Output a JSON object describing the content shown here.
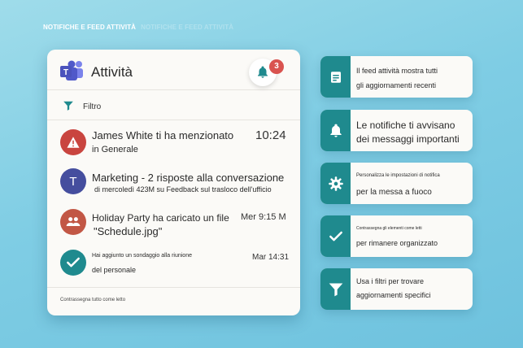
{
  "page": {
    "heading": "NOTIFICHE E FEED ATTIVITÀ",
    "heading_ghost": "NOTIFICHE E FEED ATTIVITÀ"
  },
  "panel": {
    "title": "Attività",
    "badge_count": "3",
    "filter_label": "Filtro",
    "footer_link": "Contrassegna tutto come letto"
  },
  "activity": [
    {
      "title": "James White ti ha menzionato",
      "subtitle": "in Generale",
      "time": "10:24",
      "icon": "alert-icon",
      "color": "#c9453f"
    },
    {
      "title": "Marketing - 2 risposte alla conversazione",
      "subtitle": "di mercoledì 423M su Feedback sul trasloco dell'ufficio",
      "time": "",
      "initial": "T",
      "color": "#454e9e"
    },
    {
      "title": "Holiday Party ha caricato un file",
      "subtitle": "\"Schedule.jpg\"",
      "time": "Mer 9:15 M",
      "icon": "people-icon",
      "color": "#c25745"
    },
    {
      "title": "Hai aggiunto un sondaggio alla riunione",
      "subtitle": "del personale",
      "time": "Mar 14:31",
      "icon": "check-icon",
      "color": "#1f8a8e"
    }
  ],
  "features": [
    {
      "icon": "document-icon",
      "line1": "Il feed attività mostra tutti",
      "line2": "gli aggiornamenti recenti"
    },
    {
      "icon": "bell-icon",
      "line1": "Le notifiche ti avvisano",
      "line2": "dei messaggi importanti"
    },
    {
      "icon": "gear-icon",
      "line1": "Personalizza le impostazioni di notifica",
      "line2": "per la messa a fuoco"
    },
    {
      "icon": "check-icon",
      "line1": "Contrassegna gli elementi come letti",
      "line2": "per rimanere organizzato"
    },
    {
      "icon": "filter-icon",
      "line1": "Usa i filtri per trovare",
      "line2": "aggiornamenti specifici"
    }
  ],
  "colors": {
    "accent": "#1f8a8e",
    "badge": "#d9534f",
    "teams_purple": "#5059c9"
  }
}
